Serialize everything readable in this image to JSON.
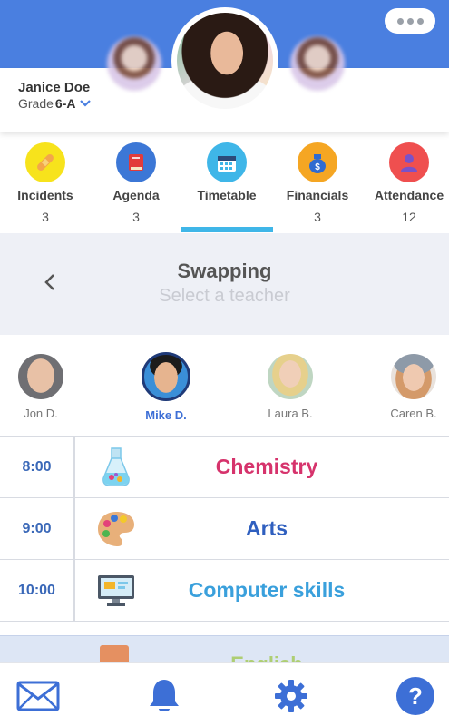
{
  "header": {
    "student_name": "Janice Doe",
    "grade_prefix": "Grade",
    "grade_value": "6-A",
    "menu_icon": "more-dots-icon",
    "colors": {
      "primary": "#4a7fe0",
      "accent": "#3fb6e8"
    }
  },
  "nav": {
    "items": [
      {
        "label": "Incidents",
        "count": "3",
        "icon": "bandage-icon",
        "color": "#f7e31c"
      },
      {
        "label": "Agenda",
        "count": "3",
        "icon": "book-icon",
        "color": "#3c77d6"
      },
      {
        "label": "Timetable",
        "count": "",
        "icon": "calendar-icon",
        "color": "#3fb6e8"
      },
      {
        "label": "Financials",
        "count": "3",
        "icon": "money-bag-icon",
        "color": "#f5a623"
      },
      {
        "label": "Attendance",
        "count": "12",
        "icon": "person-icon",
        "color": "#ef4f4f"
      }
    ],
    "active": "Timetable"
  },
  "swap": {
    "title": "Swapping",
    "subtitle": "Select a teacher"
  },
  "teachers": [
    {
      "name": "Jon D.",
      "selected": false
    },
    {
      "name": "Mike D.",
      "selected": true
    },
    {
      "name": "Laura B.",
      "selected": false
    },
    {
      "name": "Caren B.",
      "selected": false
    }
  ],
  "schedule": [
    {
      "time": "8:00",
      "subject": "Chemistry",
      "icon": "flask-icon",
      "color": "#d6336c"
    },
    {
      "time": "9:00",
      "subject": "Arts",
      "icon": "palette-icon",
      "color": "#2f5fbf"
    },
    {
      "time": "10:00",
      "subject": "Computer skills",
      "icon": "monitor-icon",
      "color": "#3aa0dc"
    },
    {
      "time": "",
      "subject": "English",
      "icon": "book-icon",
      "color": "#9bc53d"
    }
  ],
  "tabbar": [
    "mail-icon",
    "bell-icon",
    "gear-icon",
    "help-icon"
  ]
}
